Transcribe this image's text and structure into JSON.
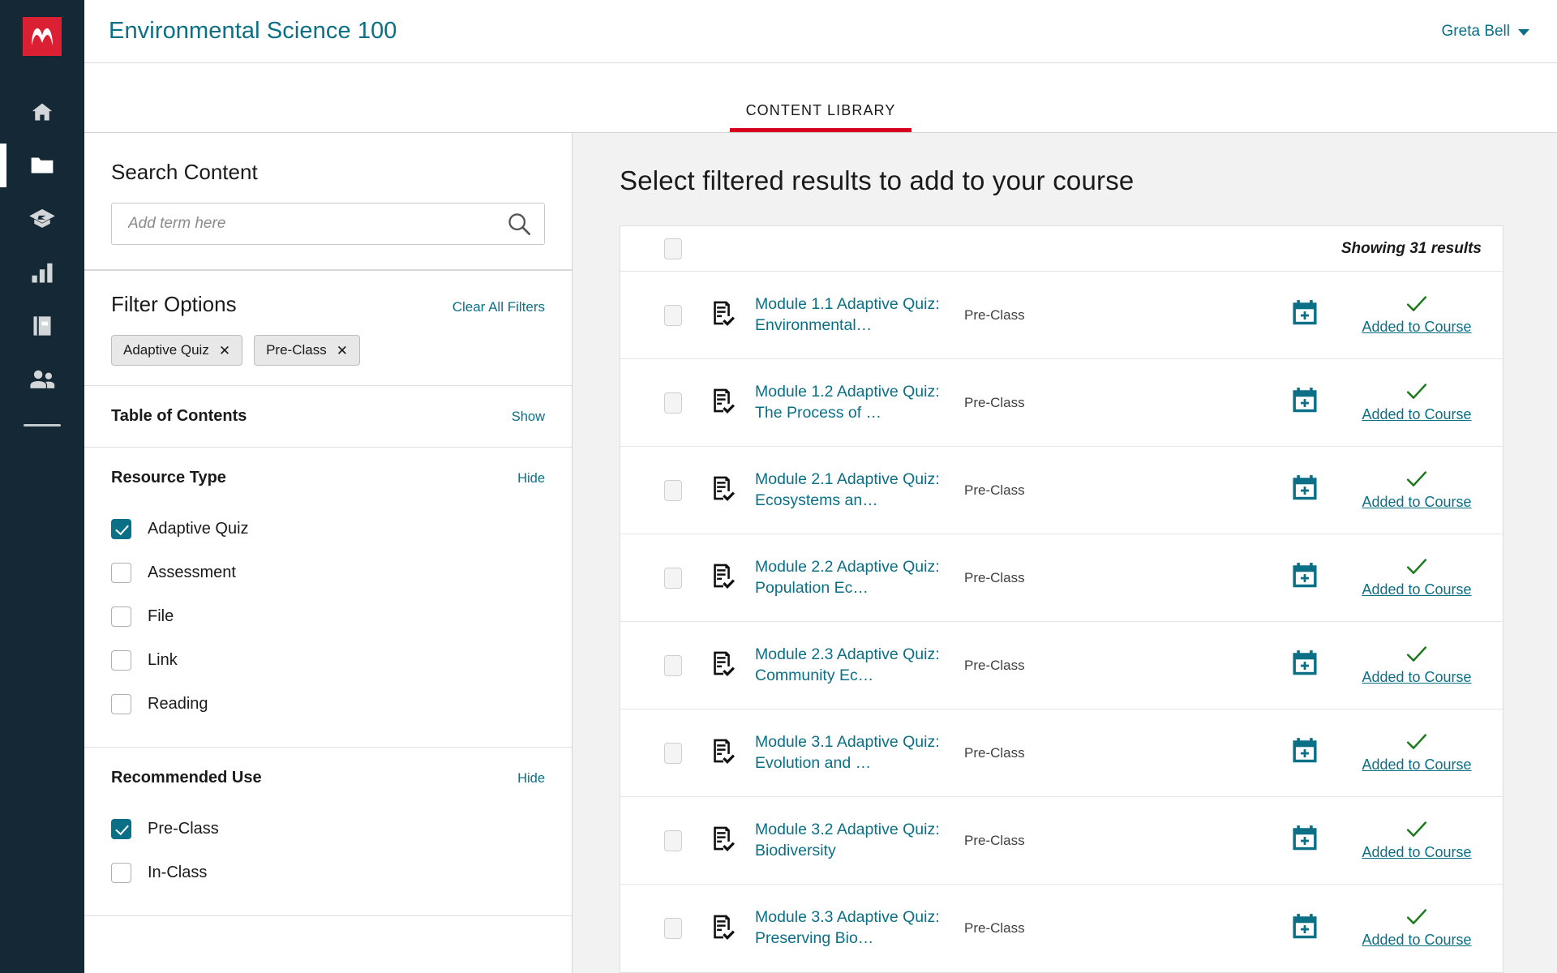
{
  "rail": {
    "logo_icon": "mcgraw-hill-logo-icon",
    "items": [
      {
        "icon": "home-icon",
        "name": "home",
        "active": false
      },
      {
        "icon": "folder-icon",
        "name": "courses",
        "active": true
      },
      {
        "icon": "graduation-cap-icon",
        "name": "learning",
        "active": false
      },
      {
        "icon": "bar-chart-icon",
        "name": "reports",
        "active": false
      },
      {
        "icon": "book-icon",
        "name": "ebook",
        "active": false
      },
      {
        "icon": "people-icon",
        "name": "roster",
        "active": false
      }
    ]
  },
  "header": {
    "course_title": "Environmental Science 100",
    "user_name": "Greta Bell",
    "caret_icon": "chevron-down-icon"
  },
  "tabs": [
    {
      "label": "CONTENT LIBRARY",
      "active": true
    }
  ],
  "filters": {
    "search": {
      "title": "Search Content",
      "placeholder": "Add term here",
      "value": "",
      "icon": "search-icon"
    },
    "filter_options": {
      "title": "Filter Options",
      "clear_all_label": "Clear All Filters",
      "chips": [
        {
          "label": "Adaptive Quiz",
          "remove_icon": "close-icon"
        },
        {
          "label": "Pre-Class",
          "remove_icon": "close-icon"
        }
      ]
    },
    "sections": [
      {
        "title": "Table of Contents",
        "toggle_label": "Show",
        "options": []
      },
      {
        "title": "Resource Type",
        "toggle_label": "Hide",
        "options": [
          {
            "label": "Adaptive Quiz",
            "checked": true
          },
          {
            "label": "Assessment",
            "checked": false
          },
          {
            "label": "File",
            "checked": false
          },
          {
            "label": "Link",
            "checked": false
          },
          {
            "label": "Reading",
            "checked": false
          }
        ]
      },
      {
        "title": "Recommended Use",
        "toggle_label": "Hide",
        "options": [
          {
            "label": "Pre-Class",
            "checked": true
          },
          {
            "label": "In-Class",
            "checked": false
          }
        ]
      }
    ]
  },
  "results": {
    "title": "Select filtered results to add to your course",
    "showing": "Showing 31 results",
    "select_all_checked": false,
    "rows": [
      {
        "title": "Module 1.1 Adaptive Quiz: Environmental…",
        "use": "Pre-Class",
        "doc_icon": "quiz-document-icon",
        "calendar_icon": "calendar-add-icon",
        "status_icon": "check-icon",
        "status_label": "Added to Course",
        "checked": false
      },
      {
        "title": "Module 1.2 Adaptive Quiz: The Process of …",
        "use": "Pre-Class",
        "doc_icon": "quiz-document-icon",
        "calendar_icon": "calendar-add-icon",
        "status_icon": "check-icon",
        "status_label": "Added to Course",
        "checked": false
      },
      {
        "title": "Module 2.1 Adaptive Quiz: Ecosystems an…",
        "use": "Pre-Class",
        "doc_icon": "quiz-document-icon",
        "calendar_icon": "calendar-add-icon",
        "status_icon": "check-icon",
        "status_label": "Added to Course",
        "checked": false
      },
      {
        "title": "Module 2.2 Adaptive Quiz: Population Ec…",
        "use": "Pre-Class",
        "doc_icon": "quiz-document-icon",
        "calendar_icon": "calendar-add-icon",
        "status_icon": "check-icon",
        "status_label": "Added to Course",
        "checked": false
      },
      {
        "title": "Module 2.3 Adaptive Quiz: Community Ec…",
        "use": "Pre-Class",
        "doc_icon": "quiz-document-icon",
        "calendar_icon": "calendar-add-icon",
        "status_icon": "check-icon",
        "status_label": "Added to Course",
        "checked": false
      },
      {
        "title": "Module 3.1 Adaptive Quiz: Evolution and …",
        "use": "Pre-Class",
        "doc_icon": "quiz-document-icon",
        "calendar_icon": "calendar-add-icon",
        "status_icon": "check-icon",
        "status_label": "Added to Course",
        "checked": false
      },
      {
        "title": "Module 3.2 Adaptive Quiz: Biodiversity",
        "use": "Pre-Class",
        "doc_icon": "quiz-document-icon",
        "calendar_icon": "calendar-add-icon",
        "status_icon": "check-icon",
        "status_label": "Added to Course",
        "checked": false
      },
      {
        "title": "Module 3.3 Adaptive Quiz: Preserving Bio…",
        "use": "Pre-Class",
        "doc_icon": "quiz-document-icon",
        "calendar_icon": "calendar-add-icon",
        "status_icon": "check-icon",
        "status_label": "Added to Course",
        "checked": false
      }
    ]
  },
  "colors": {
    "rail_bg": "#152835",
    "logo_red": "#da2032",
    "accent_teal": "#0b6f86",
    "tab_underline_red": "#d6001c",
    "check_green": "#1a7a1a",
    "results_bg": "#f2f2f2"
  }
}
